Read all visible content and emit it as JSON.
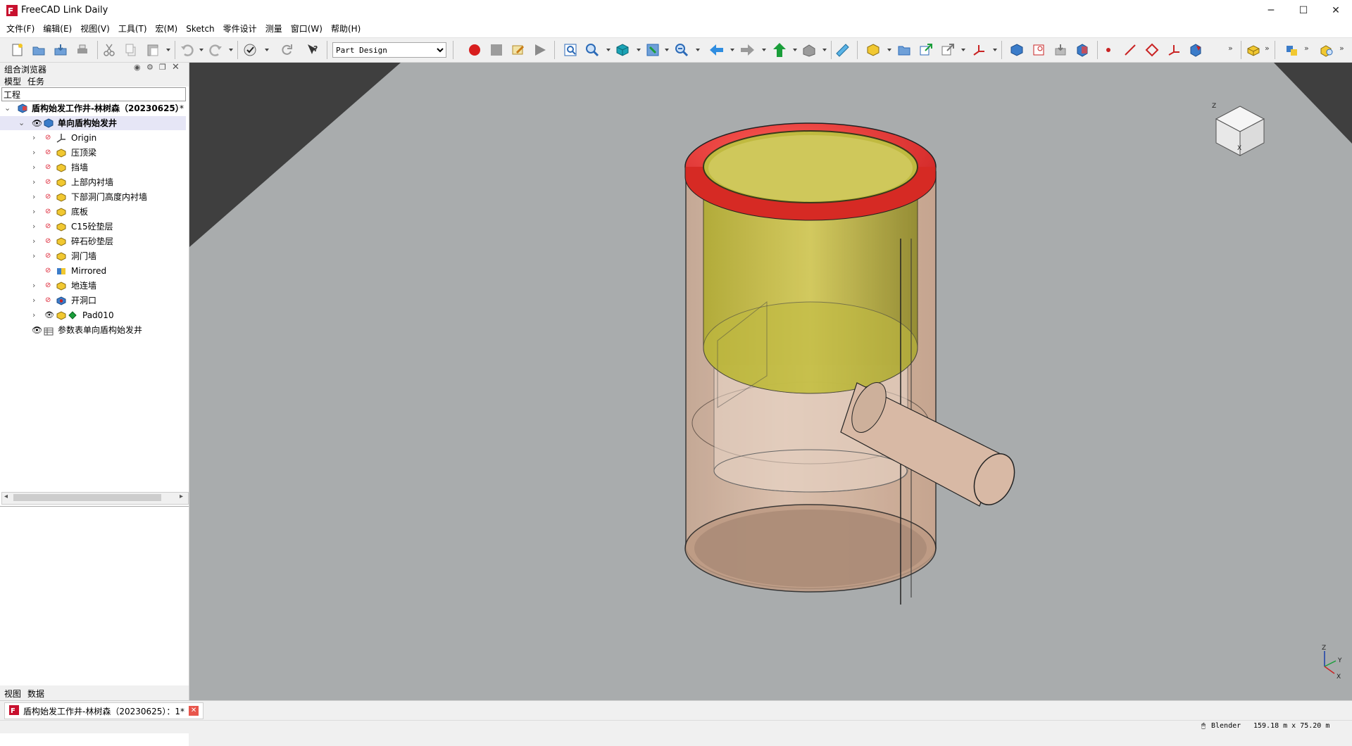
{
  "window": {
    "title": "FreeCAD Link Daily",
    "minimize": "─",
    "maximize": "☐",
    "close": "✕"
  },
  "menu": [
    "文件(F)",
    "编辑(E)",
    "视图(V)",
    "工具(T)",
    "宏(M)",
    "Sketch",
    "零件设计",
    "测量",
    "窗口(W)",
    "帮助(H)"
  ],
  "toolbar": {
    "workbench": "Part Design"
  },
  "panel": {
    "title": "组合浏览器",
    "tabs": [
      "模型",
      "任务"
    ],
    "tree_header": "工程",
    "document": "盾构始发工作井-林树森（20230625）",
    "modified_mark": "*",
    "body": "单向盾构始发井",
    "children": [
      "Origin",
      "压顶梁",
      "挡墙",
      "上部内衬墙",
      "下部洞门高度内衬墙",
      "底板",
      "C15砼垫层",
      "碎石砂垫层",
      "洞门墙",
      "Mirrored",
      "地连墙",
      "开洞口",
      "Pad010"
    ],
    "spreadsheet": "参数表单向盾构始发井",
    "bottom_tabs": [
      "视图",
      "数据"
    ]
  },
  "navcube": {
    "axes": [
      "Z",
      "Y",
      "X"
    ]
  },
  "doc_tab": {
    "label": "盾构始发工作井-林树森（20230625）：1*"
  },
  "status": {
    "nav_style": "Blender",
    "dimensions": "159.18 m x 75.20 m"
  },
  "colors": {
    "viewport": "#a9acad",
    "ring": "#e8342f",
    "upper_wall": "#c9c24a",
    "shaft": "#d8b9a5"
  }
}
